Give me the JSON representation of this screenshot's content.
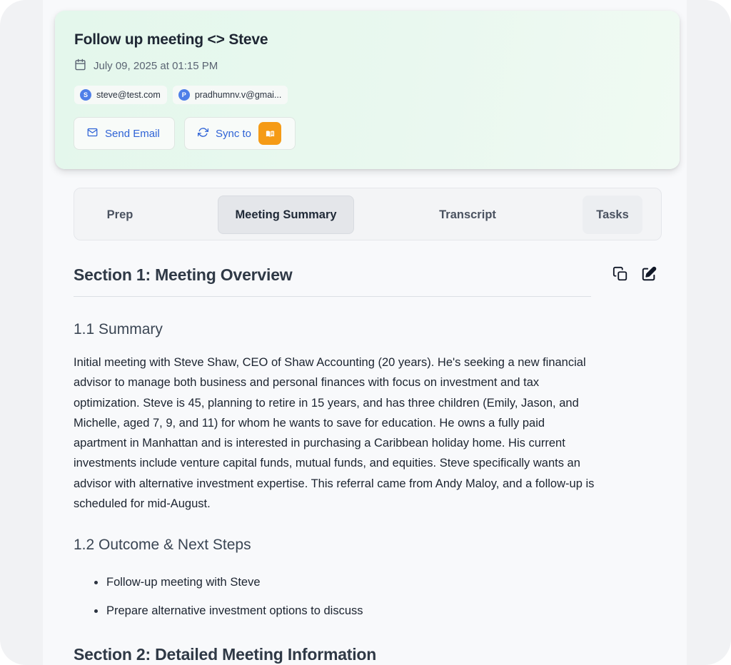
{
  "meeting": {
    "title": "Follow up meeting <> Steve",
    "datetime": "July 09, 2025 at 01:15 PM",
    "participants": [
      {
        "initial": "S",
        "email": "steve@test.com"
      },
      {
        "initial": "P",
        "email": "pradhumnv.v@gmai..."
      }
    ],
    "send_email_label": "Send Email",
    "sync_label": "Sync to"
  },
  "tabs": [
    {
      "label": "Prep",
      "active": false
    },
    {
      "label": "Meeting Summary",
      "active": true
    },
    {
      "label": "Transcript",
      "active": false
    },
    {
      "label": "Tasks",
      "active": false
    }
  ],
  "content": {
    "section1_title": "Section 1: Meeting Overview",
    "summary_heading": "1.1 Summary",
    "summary_text": "Initial meeting with Steve Shaw, CEO of Shaw Accounting (20 years). He's seeking a new financial advisor to manage both business and personal finances with focus on investment and tax optimization. Steve is 45, planning to retire in 15 years, and has three children (Emily, Jason, and Michelle, aged 7, 9, and 11) for whom he wants to save for education. He owns a fully paid apartment in Manhattan and is interested in purchasing a Caribbean holiday home. His current investments include venture capital funds, mutual funds, and equities. Steve specifically wants an advisor with alternative investment expertise. This referral came from Andy Maloy, and a follow-up is scheduled for mid-August.",
    "outcome_heading": "1.2 Outcome & Next Steps",
    "next_steps": [
      "Follow-up meeting with Steve",
      "Prepare alternative investment options to discuss"
    ],
    "section2_title": "Section 2: Detailed Meeting Information"
  },
  "icons": {
    "date": "calendar-icon",
    "email": "mail-icon",
    "sync": "refresh-icon",
    "copy": "copy-icon",
    "edit": "edit-icon"
  },
  "colors": {
    "accent_blue": "#2f63d6",
    "avatar_blue": "#4f7fe8",
    "sync_brand": "#f59b16",
    "header_green": "#e4f7ec"
  }
}
